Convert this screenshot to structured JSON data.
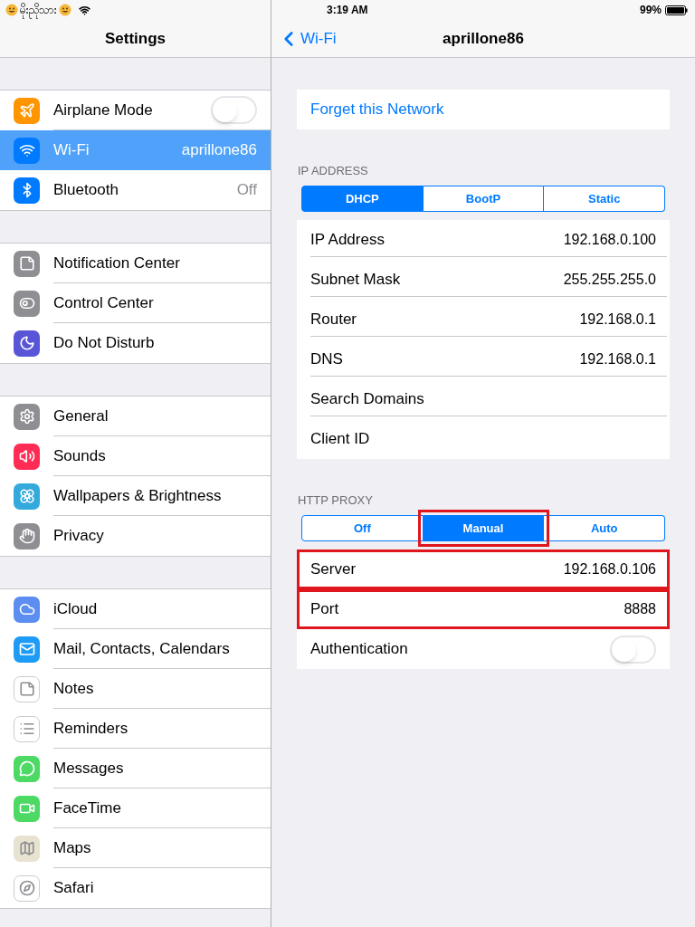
{
  "status_bar": {
    "carrier": "မိုးညိုသား",
    "time": "3:19 AM",
    "battery": "99%"
  },
  "sidebar": {
    "title": "Settings",
    "sections": [
      [
        {
          "label": "Airplane Mode",
          "kind": "toggle",
          "on": false,
          "selected": false
        },
        {
          "label": "Wi-Fi",
          "value": "aprillone86",
          "kind": "value",
          "selected": true
        },
        {
          "label": "Bluetooth",
          "value": "Off",
          "kind": "value",
          "selected": false
        }
      ],
      [
        {
          "label": "Notification Center",
          "kind": "link",
          "selected": false
        },
        {
          "label": "Control Center",
          "kind": "link",
          "selected": false
        },
        {
          "label": "Do Not Disturb",
          "kind": "link",
          "selected": false
        }
      ],
      [
        {
          "label": "General",
          "kind": "link",
          "selected": false
        },
        {
          "label": "Sounds",
          "kind": "link",
          "selected": false
        },
        {
          "label": "Wallpapers & Brightness",
          "kind": "link",
          "selected": false
        },
        {
          "label": "Privacy",
          "kind": "link",
          "selected": false
        }
      ],
      [
        {
          "label": "iCloud",
          "kind": "link",
          "selected": false
        },
        {
          "label": "Mail, Contacts, Calendars",
          "kind": "link",
          "selected": false
        },
        {
          "label": "Notes",
          "kind": "link",
          "selected": false
        },
        {
          "label": "Reminders",
          "kind": "link",
          "selected": false
        },
        {
          "label": "Messages",
          "kind": "link",
          "selected": false
        },
        {
          "label": "FaceTime",
          "kind": "link",
          "selected": false
        },
        {
          "label": "Maps",
          "kind": "link",
          "selected": false
        },
        {
          "label": "Safari",
          "kind": "link",
          "selected": false
        }
      ]
    ]
  },
  "detail": {
    "back": "Wi-Fi",
    "title": "aprillone86",
    "forget": "Forget this Network",
    "ip_section": {
      "header": "IP ADDRESS",
      "segments": [
        {
          "label": "DHCP",
          "selected": true,
          "highlighted": false
        },
        {
          "label": "BootP",
          "selected": false,
          "highlighted": false
        },
        {
          "label": "Static",
          "selected": false,
          "highlighted": false
        }
      ],
      "rows": [
        {
          "label": "IP Address",
          "value": "192.168.0.100",
          "kind": "value",
          "highlighted": false
        },
        {
          "label": "Subnet Mask",
          "value": "255.255.255.0",
          "kind": "value",
          "highlighted": false
        },
        {
          "label": "Router",
          "value": "192.168.0.1",
          "kind": "value",
          "highlighted": false
        },
        {
          "label": "DNS",
          "value": "192.168.0.1",
          "kind": "value",
          "highlighted": false
        },
        {
          "label": "Search Domains",
          "kind": "value",
          "highlighted": false
        },
        {
          "label": "Client ID",
          "kind": "value",
          "highlighted": false
        }
      ]
    },
    "proxy_section": {
      "header": "HTTP PROXY",
      "segments": [
        {
          "label": "Off",
          "selected": false,
          "highlighted": false
        },
        {
          "label": "Manual",
          "selected": true,
          "highlighted": true
        },
        {
          "label": "Auto",
          "selected": false,
          "highlighted": false
        }
      ],
      "rows": [
        {
          "label": "Server",
          "value": "192.168.0.106",
          "kind": "value",
          "highlighted": true
        },
        {
          "label": "Port",
          "value": "8888",
          "kind": "value",
          "highlighted": true
        },
        {
          "label": "Authentication",
          "kind": "toggle",
          "on": false,
          "highlighted": false
        }
      ]
    }
  }
}
